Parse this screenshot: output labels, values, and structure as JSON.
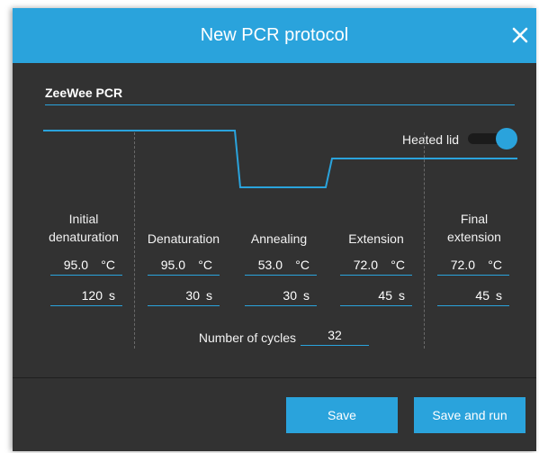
{
  "dialog": {
    "title": "New PCR protocol",
    "close_icon": "close-icon"
  },
  "protocol_name": "ZeeWee PCR",
  "heated_lid": {
    "label": "Heated lid",
    "enabled": true
  },
  "steps": [
    {
      "label": "Initial denaturation",
      "temperature": "95.0",
      "temp_unit": "°C",
      "duration": "120",
      "time_unit": "s"
    },
    {
      "label": "Denaturation",
      "temperature": "95.0",
      "temp_unit": "°C",
      "duration": "30",
      "time_unit": "s"
    },
    {
      "label": "Annealing",
      "temperature": "53.0",
      "temp_unit": "°C",
      "duration": "30",
      "time_unit": "s"
    },
    {
      "label": "Extension",
      "temperature": "72.0",
      "temp_unit": "°C",
      "duration": "45",
      "time_unit": "s"
    },
    {
      "label": "Final extension",
      "temperature": "72.0",
      "temp_unit": "°C",
      "duration": "45",
      "time_unit": "s"
    }
  ],
  "cycles": {
    "label": "Number of cycles",
    "value": "32"
  },
  "buttons": {
    "save": "Save",
    "save_and_run": "Save and run"
  },
  "colors": {
    "accent": "#2aa3dc",
    "dialog_bg": "#323232",
    "divider": "#6a6a6a"
  }
}
